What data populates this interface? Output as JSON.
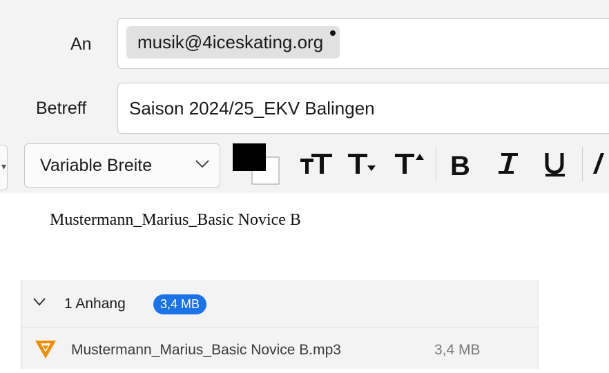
{
  "compose": {
    "to_label": "An",
    "recipients": [
      "musik@4iceskating.org"
    ],
    "subject_label": "Betreff",
    "subject_value": "Saison 2024/25_EKV Balingen"
  },
  "toolbar": {
    "font_family_value": "Variable Breite",
    "text_color": "#000000",
    "bg_color": "#ffffff",
    "icons": [
      "text-size-icon",
      "text-smaller-icon",
      "text-larger-icon",
      "bold-icon",
      "italic-icon",
      "underline-icon"
    ]
  },
  "body": {
    "text": "Mustermann_Marius_Basic Novice B"
  },
  "attachments": {
    "header": "1 Anhang",
    "total_size": "3,4 MB",
    "items": [
      {
        "name": "Mustermann_Marius_Basic Novice B.mp3",
        "size": "3,4 MB",
        "icon": "vlc-icon"
      }
    ]
  },
  "colors": {
    "accent": "#1a73e8",
    "header_bg": "#f3f3f3",
    "vlc_orange": "#f08c00"
  }
}
